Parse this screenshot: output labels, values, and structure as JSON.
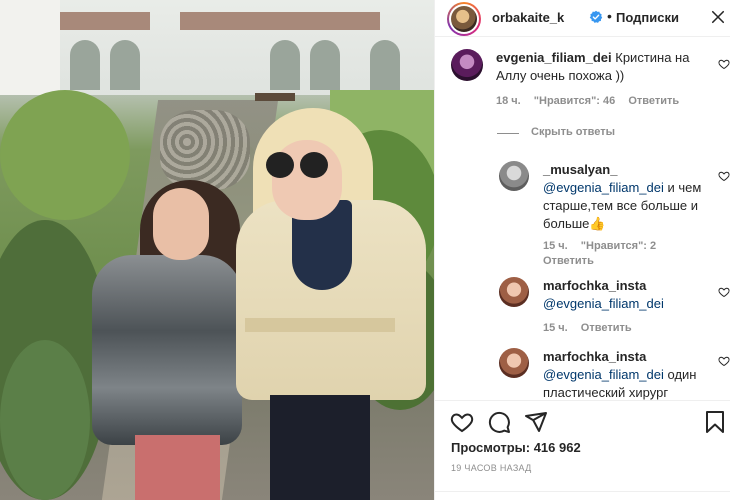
{
  "post": {
    "author": "orbakaite_k",
    "separator": "•",
    "follow_label": "Подписки"
  },
  "comments": [
    {
      "username": "evgenia_filiam_dei",
      "text": "Кристина на Аллу очень похожа ))",
      "time": "18 ч.",
      "likes": "\"Нравится\": 46",
      "reply": "Ответить"
    }
  ],
  "hide_replies_label": "Скрыть ответы",
  "replies": [
    {
      "username": "_musalyan_",
      "mention": "@evgenia_filiam_dei",
      "text": " и чем старше,тем все больше и больше",
      "emoji": "👍",
      "time": "15 ч.",
      "likes": "\"Нравится\": 2",
      "reply": "Ответить"
    },
    {
      "username": "marfochka_insta",
      "mention": "@evgenia_filiam_dei",
      "text": "",
      "time": "15 ч.",
      "reply": "Ответить"
    },
    {
      "username": "marfochka_insta",
      "mention": "@evgenia_filiam_dei",
      "text": " один пластический хирург"
    }
  ],
  "stats": {
    "views": "Просмотры: 416 962",
    "time_ago": "19 ЧАСОВ НАЗАД"
  },
  "colors": {
    "mention": "#00376b",
    "verified": "#3897f0",
    "meta": "#8e8e8e"
  },
  "icons": [
    "heart-icon",
    "comment-icon",
    "share-icon",
    "bookmark-icon",
    "verified-icon",
    "more-icon"
  ]
}
